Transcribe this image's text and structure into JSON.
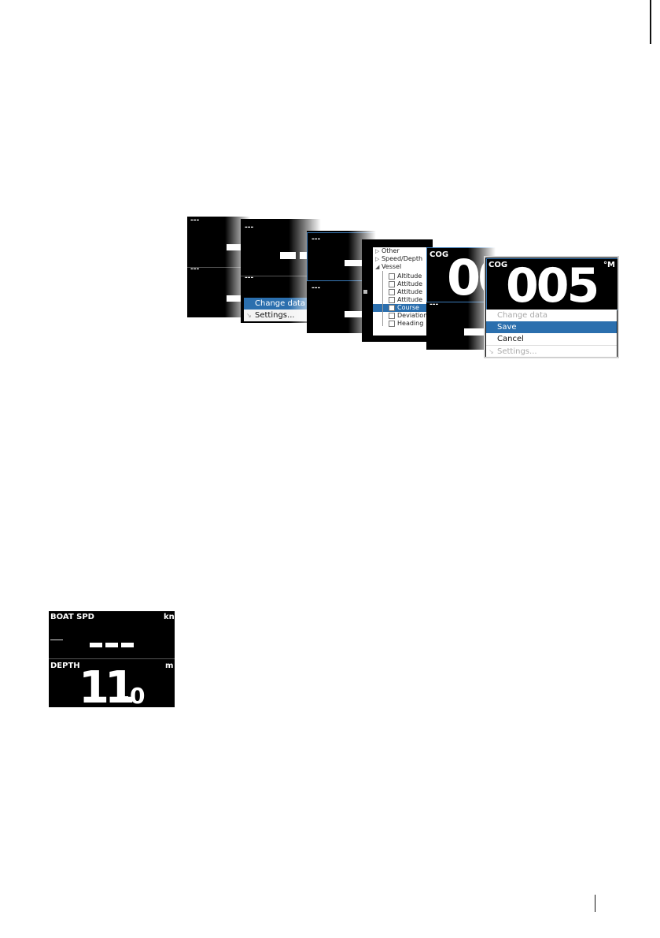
{
  "sequence": {
    "screen1": {
      "top_label": "---",
      "bottom_label": "---"
    },
    "screen2": {
      "top_label": "---",
      "bottom_label": "---",
      "menu": [
        {
          "label": "Change data",
          "selected": true
        },
        {
          "label": "Settings...",
          "selected": false
        }
      ]
    },
    "screen3": {
      "top_label": "---",
      "bottom_label": "---"
    },
    "screen4": {
      "tree": [
        {
          "label": "Other",
          "indent": 0,
          "expander": "▷"
        },
        {
          "label": "Speed/Depth",
          "indent": 0,
          "expander": "▷"
        },
        {
          "label": "Vessel",
          "indent": 0,
          "expander": "◢"
        },
        {
          "label": "Altitude",
          "indent": 2,
          "check": true
        },
        {
          "label": "Attitude",
          "indent": 2,
          "check": true
        },
        {
          "label": "Attitude",
          "indent": 2,
          "check": true
        },
        {
          "label": "Attitude",
          "indent": 2,
          "check": true
        },
        {
          "label": "Course",
          "indent": 2,
          "check": true,
          "selected": true
        },
        {
          "label": "Deviation",
          "indent": 2,
          "check": true
        },
        {
          "label": "Heading",
          "indent": 2,
          "check": true
        }
      ]
    },
    "screen5": {
      "label": "COG",
      "value": "00",
      "bottom_label": "---"
    },
    "screen6": {
      "label": "COG",
      "value": "005",
      "unit": "°M",
      "menu": [
        {
          "label": "Change data",
          "state": "disabled"
        },
        {
          "label": "Save",
          "state": "selected"
        },
        {
          "label": "Cancel",
          "state": "normal"
        },
        {
          "label": "Settings...",
          "state": "disabled"
        }
      ]
    }
  },
  "gauge": {
    "top": {
      "label": "BOAT SPD",
      "unit": "kn"
    },
    "bottom": {
      "label": "DEPTH",
      "unit": "m",
      "value_int": "11",
      "value_dec": "0"
    }
  },
  "colors": {
    "accent": "#2b6fae",
    "screen_bg": "#000000",
    "frame_blue": "#3a7ab8"
  }
}
